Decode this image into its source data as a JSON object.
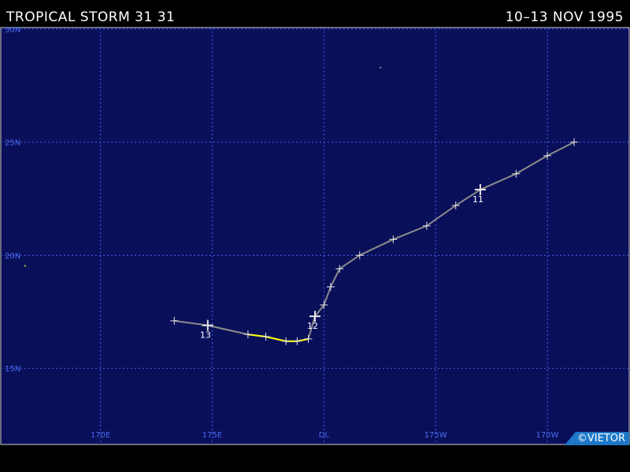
{
  "header": {
    "title": "TROPICAL STORM 31 31",
    "date_range": "10–13 NOV 1995"
  },
  "credit": "©VIETOR",
  "colors": {
    "background": "#000000",
    "ocean": "#0a0f5a",
    "grid": "#3f5fe0",
    "axis_label": "#4a6cf0",
    "track": "#8c8c8c",
    "track_highlight": "#ffff00",
    "marker": "#e6e6e6",
    "credit_bg": "#1e78c8"
  },
  "map": {
    "lon_range": [
      165.5,
      193.7
    ],
    "lat_range": [
      11.6,
      30.1
    ],
    "lat_lines": [
      {
        "lat": 30,
        "label": "30N"
      },
      {
        "lat": 25,
        "label": "25N"
      },
      {
        "lat": 20,
        "label": "20N"
      },
      {
        "lat": 15,
        "label": "15N"
      }
    ],
    "lon_lines": [
      {
        "lon": 170,
        "label": "170E"
      },
      {
        "lon": 175,
        "label": "175E"
      },
      {
        "lon": 180,
        "label": "DL"
      },
      {
        "lon": 185,
        "label": "175W"
      },
      {
        "lon": 190,
        "label": "170W"
      }
    ],
    "track": [
      {
        "lon": 191.2,
        "lat": 25.0
      },
      {
        "lon": 190.0,
        "lat": 24.4
      },
      {
        "lon": 188.6,
        "lat": 23.6
      },
      {
        "lon": 187.0,
        "lat": 22.9,
        "day": "11"
      },
      {
        "lon": 185.9,
        "lat": 22.2
      },
      {
        "lon": 184.6,
        "lat": 21.3
      },
      {
        "lon": 183.1,
        "lat": 20.7
      },
      {
        "lon": 181.6,
        "lat": 20.0
      },
      {
        "lon": 180.7,
        "lat": 19.4
      },
      {
        "lon": 180.3,
        "lat": 18.6
      },
      {
        "lon": 180.0,
        "lat": 17.8
      },
      {
        "lon": 179.6,
        "lat": 17.3,
        "day": "12"
      },
      {
        "lon": 179.3,
        "lat": 16.3
      },
      {
        "lon": 178.8,
        "lat": 16.2
      },
      {
        "lon": 178.3,
        "lat": 16.2
      },
      {
        "lon": 177.4,
        "lat": 16.4
      },
      {
        "lon": 176.6,
        "lat": 16.5
      },
      {
        "lon": 174.8,
        "lat": 16.9,
        "day": "13"
      },
      {
        "lon": 173.3,
        "lat": 17.1
      }
    ],
    "highlight_segment": [
      12,
      16
    ]
  }
}
